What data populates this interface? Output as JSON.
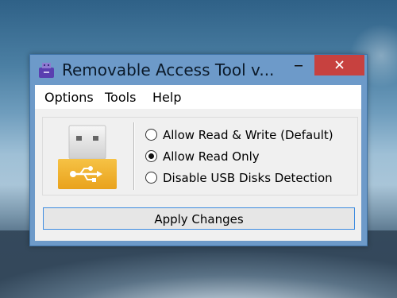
{
  "window": {
    "title": "Removable Access Tool v...",
    "accent": "#6d9ac9",
    "close_color": "#c7413f",
    "controls": {
      "minimize": "minimize-icon",
      "maximize": "maximize-icon",
      "close": "close-icon"
    }
  },
  "menu": {
    "items": [
      {
        "label": "Options"
      },
      {
        "label": "Tools"
      },
      {
        "label": "Help"
      }
    ]
  },
  "options": {
    "icon": "usb-drive-icon",
    "items": [
      {
        "label": "Allow Read & Write (Default)",
        "selected": false
      },
      {
        "label": "Allow Read Only",
        "selected": true
      },
      {
        "label": "Disable USB Disks Detection",
        "selected": false
      }
    ]
  },
  "actions": {
    "apply_label": "Apply Changes"
  }
}
